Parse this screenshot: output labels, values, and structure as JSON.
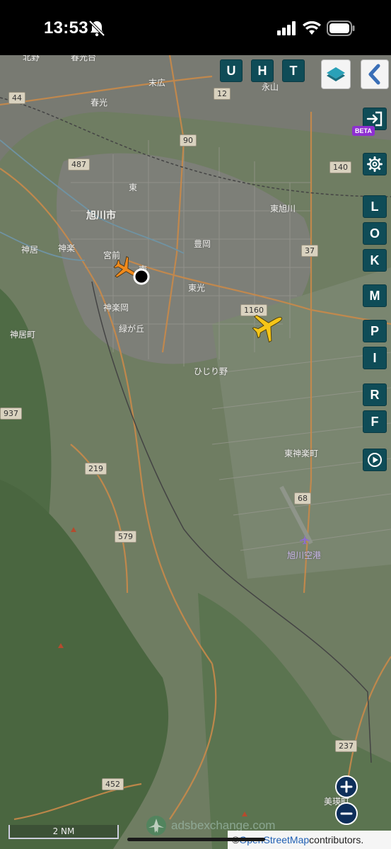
{
  "status_bar": {
    "time": "13:53",
    "icons": [
      "bell-slash-icon",
      "cellular-signal-icon",
      "wifi-icon",
      "battery-icon"
    ]
  },
  "map": {
    "place_labels": [
      {
        "text": "北野"
      },
      {
        "text": "春光台"
      },
      {
        "text": "末広"
      },
      {
        "text": "永山"
      },
      {
        "text": "春光"
      },
      {
        "text": "東"
      },
      {
        "text": "旭川市"
      },
      {
        "text": "東旭川"
      },
      {
        "text": "神居"
      },
      {
        "text": "神楽"
      },
      {
        "text": "宮前"
      },
      {
        "text": "南"
      },
      {
        "text": "豊岡"
      },
      {
        "text": "東光"
      },
      {
        "text": "神楽岡"
      },
      {
        "text": "緑が丘"
      },
      {
        "text": "神居町"
      },
      {
        "text": "ひじり野"
      },
      {
        "text": "東神楽町"
      },
      {
        "text": "旭川空港"
      },
      {
        "text": "美瑛町"
      }
    ],
    "road_shields": [
      {
        "text": "44"
      },
      {
        "text": "12"
      },
      {
        "text": "90"
      },
      {
        "text": "487"
      },
      {
        "text": "140"
      },
      {
        "text": "37"
      },
      {
        "text": "1160"
      },
      {
        "text": "937"
      },
      {
        "text": "219"
      },
      {
        "text": "68"
      },
      {
        "text": "579"
      },
      {
        "text": "237"
      },
      {
        "text": "452"
      }
    ],
    "aircraft": [
      {
        "icon": "airplane-icon",
        "color": "#f08a1c"
      },
      {
        "icon": "airplane-icon",
        "color": "#f5c518"
      }
    ]
  },
  "controls": {
    "top_buttons": [
      "U",
      "H",
      "T"
    ],
    "layers_icon": "layers-icon",
    "back_icon": "chevron-left-icon",
    "login_icon": "login-icon",
    "beta_label": "BETA",
    "settings_icon": "gear-icon",
    "side_buttons": [
      "L",
      "O",
      "K",
      "M",
      "P",
      "I",
      "R",
      "F"
    ],
    "replay_icon": "replay-icon",
    "zoom_in_icon": "plus-icon",
    "zoom_out_icon": "minus-icon"
  },
  "footer": {
    "scale": "2 NM",
    "watermark": "adsbexchange.com",
    "attribution_prefix": "© ",
    "attribution_link": "OpenStreetMap",
    "attribution_suffix": " contributors."
  },
  "colors": {
    "button_bg": "#0f4c57",
    "beta_bg": "#8e2fd1",
    "zoom_bg": "#0e2f5a",
    "aircraft_selected": "#f08a1c",
    "aircraft_other": "#f5c518"
  }
}
